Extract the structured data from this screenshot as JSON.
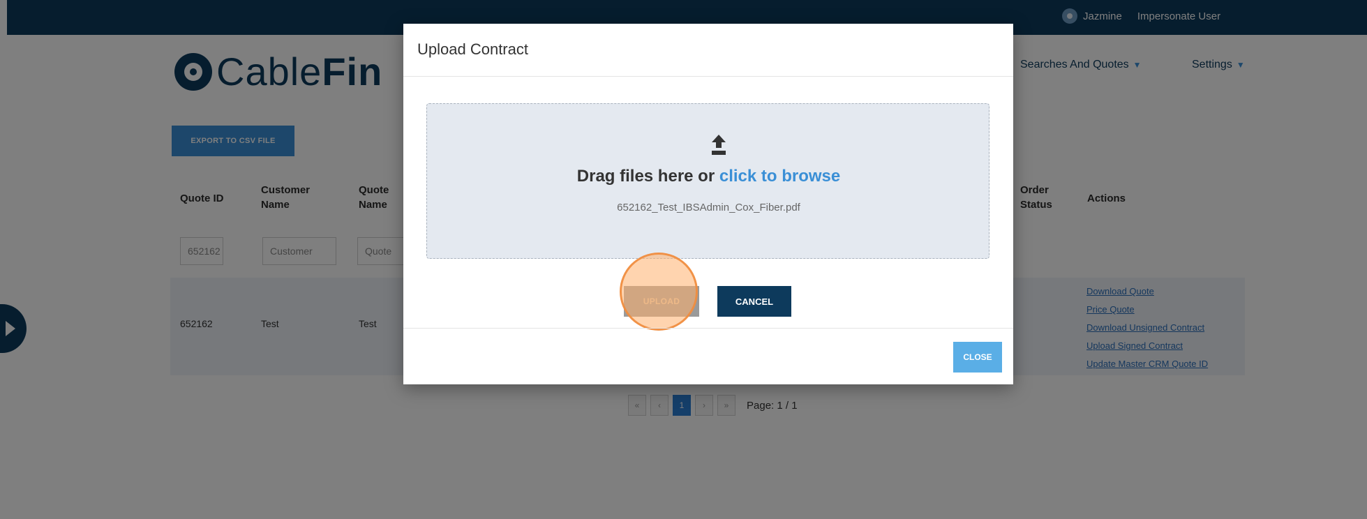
{
  "topbar": {
    "user_name": "Jazmine",
    "impersonate_label": "Impersonate User"
  },
  "header": {
    "logo_text_light": "Cable",
    "logo_text_bold": "Fin",
    "nav": [
      {
        "label": "Searches And Quotes"
      },
      {
        "label": "Settings"
      }
    ]
  },
  "toolbar": {
    "export_label": "EXPORT TO CSV FILE"
  },
  "table": {
    "headers": {
      "quote_id": "Quote ID",
      "customer_name_1": "Customer",
      "customer_name_2": "Name",
      "quote_name_1": "Quote",
      "quote_name_2": "Name",
      "order_status_1": "Order",
      "order_status_2": "Status",
      "actions": "Actions"
    },
    "filters": {
      "quote_id": "652162",
      "customer": "Customer",
      "quote": "Quote"
    },
    "row": {
      "quote_id": "652162",
      "customer": "Test",
      "quote": "Test"
    },
    "actions": [
      "Download Quote",
      "Price Quote",
      "Download Unsigned Contract",
      "Upload Signed Contract",
      "Update Master CRM Quote ID"
    ]
  },
  "pagination": {
    "first": "«",
    "prev": "‹",
    "current": "1",
    "next": "›",
    "last": "»",
    "page_label": "Page: 1 / 1"
  },
  "modal": {
    "title": "Upload Contract",
    "drop_text": "Drag files here or",
    "browse_text": "click to browse",
    "file_name": "652162_Test_IBSAdmin_Cox_Fiber.pdf",
    "upload_label": "UPLOAD",
    "cancel_label": "CANCEL",
    "close_label": "CLOSE"
  }
}
